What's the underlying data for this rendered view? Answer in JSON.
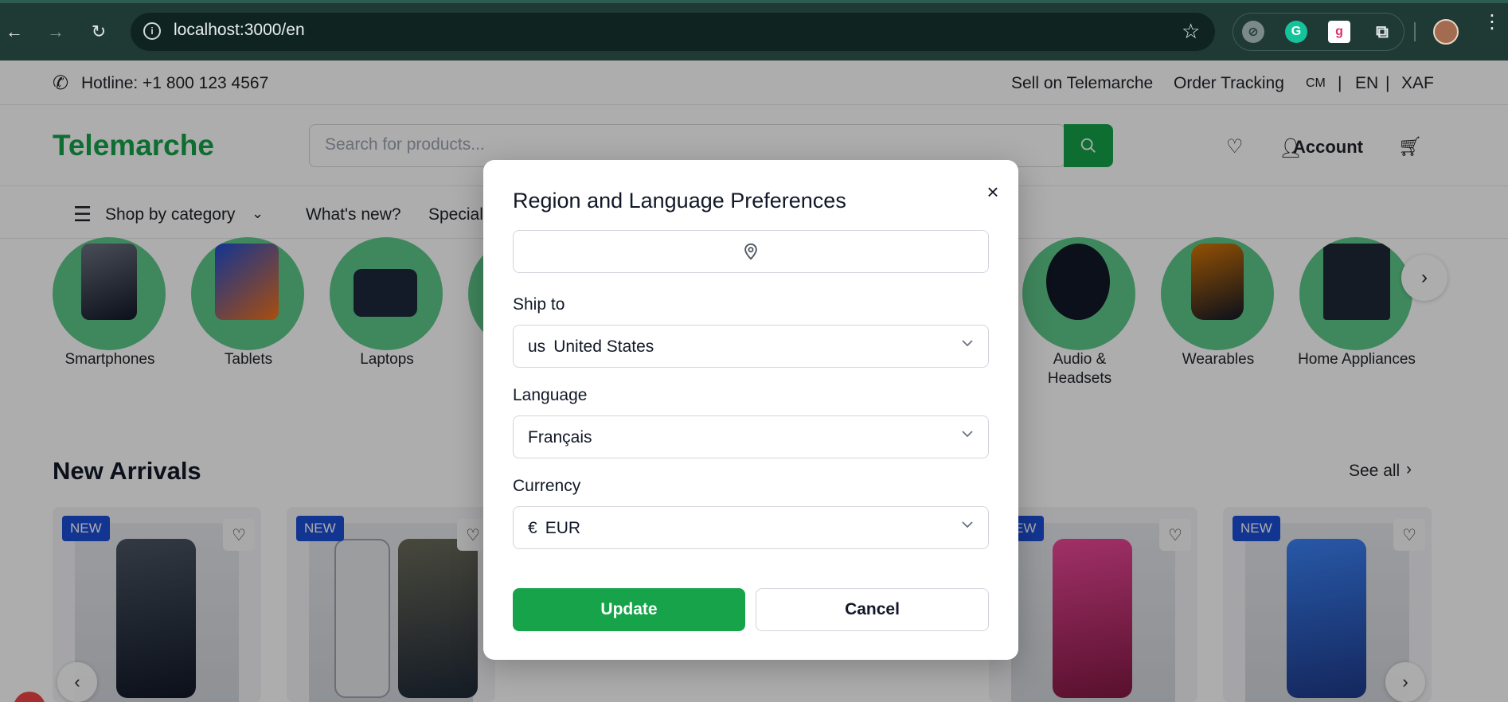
{
  "browser": {
    "url": "localhost:3000/en",
    "back_icon": "back-arrow-icon",
    "forward_icon": "forward-arrow-icon",
    "reload_icon": "reload-icon",
    "extensions": [
      "ext-icon-1",
      "grammarly-icon",
      "ext-icon-3",
      "puzzle-icon"
    ]
  },
  "topbar": {
    "hotline": "Hotline: +1 800 123 4567",
    "sell": "Sell on Telemarche",
    "tracking": "Order Tracking",
    "country": "CM",
    "sep1": "|",
    "language": "EN",
    "sep2": "|",
    "currency": "XAF"
  },
  "header": {
    "logo": "Telemarche",
    "search_placeholder": "Search for products...",
    "account": "Account"
  },
  "catnav": {
    "shop_by_category": "Shop by category",
    "whats_new": "What's new?",
    "special": "Special"
  },
  "categories": [
    {
      "label": "Smartphones"
    },
    {
      "label": "Tablets"
    },
    {
      "label": "Laptops"
    },
    {
      "label": "Audio &"
    },
    {
      "label": "Headsets"
    },
    {
      "label": "Wearables"
    },
    {
      "label": "Home Appliances"
    }
  ],
  "new_arrivals": {
    "title": "New Arrivals",
    "see_all": "See all",
    "badge": "NEW",
    "badge_partial": "EW"
  },
  "modal": {
    "title": "Region and Language Preferences",
    "close_symbol": "×",
    "ship_to_label": "Ship to",
    "ship_to_code": "us",
    "ship_to_value": "United States",
    "language_label": "Language",
    "language_value": "Français",
    "currency_label": "Currency",
    "currency_symbol": "€",
    "currency_value": "EUR",
    "update_label": "Update",
    "cancel_label": "Cancel"
  },
  "colors": {
    "brand_green": "#16a34a",
    "badge_blue": "#1d4ed8",
    "overlay": "rgba(0,0,0,0.32)"
  }
}
